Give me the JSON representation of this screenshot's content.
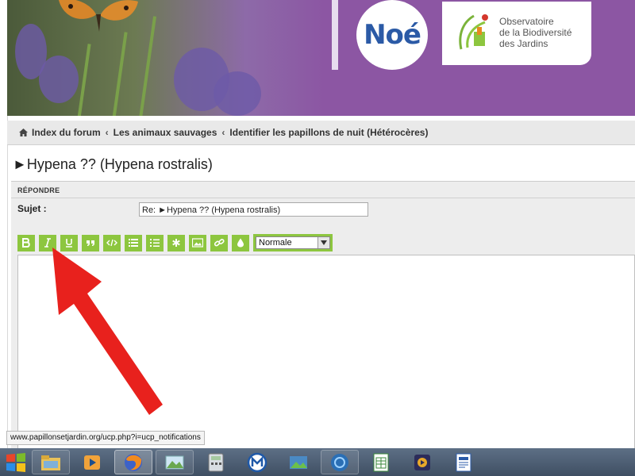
{
  "banner": {
    "noe_logo": "Noé",
    "observatoire_logo": [
      "Observatoire",
      "de la Biodiversité",
      "des Jardins"
    ]
  },
  "breadcrumb": {
    "items": [
      "Index du forum",
      "Les animaux sauvages",
      "Identifier les papillons de nuit (Hétérocères)"
    ],
    "separator": "‹"
  },
  "topic": {
    "title": "►Hypena ?? (Hypena rostralis)"
  },
  "reply": {
    "header": "RÉPONDRE",
    "subject_label": "Sujet :",
    "subject_value": "Re: ►Hypena ?? (Hypena rostralis)"
  },
  "toolbar": {
    "buttons": [
      "bold",
      "italic",
      "underline",
      "quote",
      "code",
      "list",
      "list-numbered",
      "list-item",
      "image",
      "link",
      "color"
    ],
    "font_size": "Normale",
    "accent_color": "#8dc63f"
  },
  "status_bar": {
    "url": "www.papillonsetjardin.org/ucp.php?i=ucp_notifications"
  },
  "taskbar": {
    "apps": [
      "file-explorer-icon",
      "media-player-icon",
      "firefox-icon",
      "photos-icon",
      "calculator-icon",
      "malwarebytes-icon",
      "image-viewer-icon",
      "browser-icon",
      "spreadsheet-icon",
      "media-center-icon",
      "document-icon"
    ]
  },
  "colors": {
    "banner_purple": "#8c56a3",
    "toolbar_green": "#8dc63f",
    "arrow_red": "#e8211d"
  }
}
